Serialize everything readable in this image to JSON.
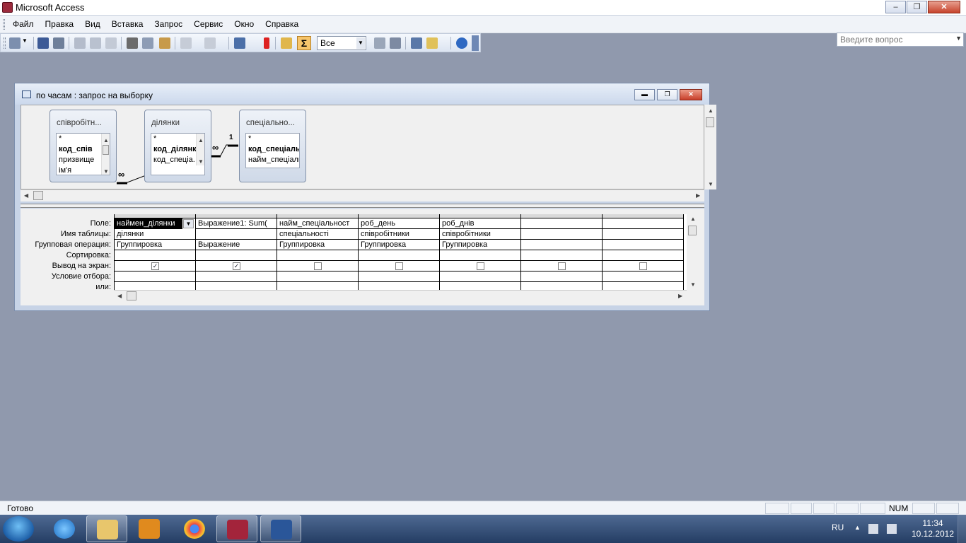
{
  "app": {
    "title": "Microsoft Access"
  },
  "window_buttons": {
    "minimize": "–",
    "restore": "❐",
    "close": "✕"
  },
  "menu": [
    "Файл",
    "Правка",
    "Вид",
    "Вставка",
    "Запрос",
    "Сервис",
    "Окно",
    "Справка"
  ],
  "help": {
    "placeholder": "Введите вопрос"
  },
  "toolbar": {
    "sigma": "Σ",
    "top_values": "Все"
  },
  "query_window": {
    "title": "по часам : запрос на выборку",
    "buttons": {
      "minimize": "▬",
      "restore": "❐",
      "close": "✕"
    }
  },
  "tables": [
    {
      "title": "співробітн...",
      "fields": [
        "*",
        "код_спів",
        "призвище",
        "ім'я"
      ],
      "key_index": 1
    },
    {
      "title": "ділянки",
      "fields": [
        "*",
        "код_ділянк",
        "код_спеціа."
      ],
      "key_index": 1
    },
    {
      "title": "спеціально...",
      "fields": [
        "*",
        "код_спеціальн",
        "найм_спеціальн"
      ],
      "key_index": 1
    }
  ],
  "relations": {
    "many": "∞",
    "one": "1"
  },
  "grid": {
    "row_labels": [
      "Поле:",
      "Имя таблицы:",
      "Групповая операция:",
      "Сортировка:",
      "Вывод на экран:",
      "Условие отбора:",
      "или:"
    ],
    "columns": [
      {
        "field": "наймен_ділянки",
        "table": "ділянки",
        "group": "Группировка",
        "show": true,
        "selected": true
      },
      {
        "field": "Выражение1: Sum(",
        "table": "",
        "group": "Выражение",
        "show": true
      },
      {
        "field": "найм_спеціальност",
        "table": "спеціальності",
        "group": "Группировка",
        "show": false
      },
      {
        "field": "роб_день",
        "table": "співробітники",
        "group": "Группировка",
        "show": false
      },
      {
        "field": "роб_днів",
        "table": "співробітники",
        "group": "Группировка",
        "show": false
      },
      {
        "field": "",
        "table": "",
        "group": "",
        "show": false
      },
      {
        "field": "",
        "table": "",
        "group": "",
        "show": false
      }
    ]
  },
  "status": {
    "text": "Готово",
    "num": "NUM"
  },
  "taskbar": {
    "lang": "RU",
    "time": "11:34",
    "date": "10.12.2012"
  },
  "colors": {
    "workspace": "#9099ad",
    "taskbar": "#2f4a73",
    "sigma": "#f7c56b"
  }
}
